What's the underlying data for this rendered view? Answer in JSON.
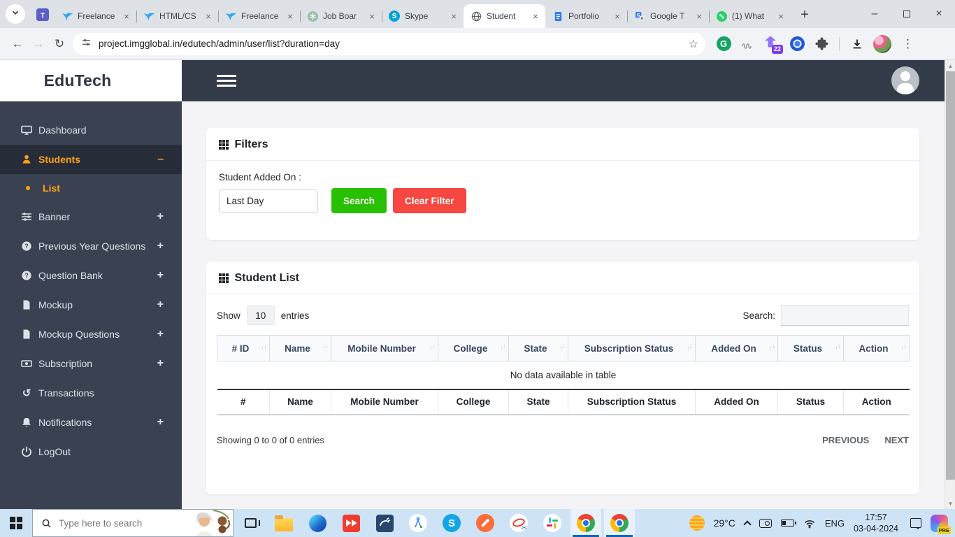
{
  "glyphs": {
    "close": "×",
    "plus": "+",
    "minus": "–",
    "back": "←",
    "forward": "→",
    "reload": "↻",
    "star": "☆",
    "menu_dots": "⋮",
    "scroll_up": "▲",
    "scroll_down": "▼",
    "sort_up": "↑",
    "sort_down": "↓",
    "window_min": "–",
    "window_close": "×",
    "new_tab": "+",
    "scissors": "✂",
    "history": "↺"
  },
  "browser": {
    "tabs": [
      {
        "label": "Freelance"
      },
      {
        "label": "HTML/CS"
      },
      {
        "label": "Freelance"
      },
      {
        "label": "Job Boar"
      },
      {
        "label": "Skype"
      },
      {
        "label": "Student"
      },
      {
        "label": "Portfolio"
      },
      {
        "label": "Google T"
      },
      {
        "label": "(1) What"
      }
    ],
    "url": "project.imgglobal.in/edutech/admin/user/list?duration=day",
    "extension_badge": "22"
  },
  "admin": {
    "brand": "EduTech",
    "menu": [
      {
        "label": "Dashboard"
      },
      {
        "label": "Students",
        "toggle": "–"
      },
      {
        "label": "List"
      },
      {
        "label": "Banner",
        "toggle": "+"
      },
      {
        "label": "Previous Year Questions",
        "toggle": "+"
      },
      {
        "label": "Question Bank",
        "toggle": "+"
      },
      {
        "label": "Mockup",
        "toggle": "+"
      },
      {
        "label": "Mockup Questions",
        "toggle": "+"
      },
      {
        "label": "Subscription",
        "toggle": "+"
      },
      {
        "label": "Transactions"
      },
      {
        "label": "Notifications",
        "toggle": "+"
      },
      {
        "label": "LogOut"
      }
    ]
  },
  "filters": {
    "title": "Filters",
    "field_label": "Student Added On :",
    "field_value": "Last Day",
    "search_button": "Search",
    "clear_button": "Clear Filter"
  },
  "student_list": {
    "title": "Student List",
    "show_label": "Show",
    "page_size": "10",
    "entries_label": "entries",
    "search_label": "Search:",
    "search_value": "",
    "columns": [
      "# ID",
      "Name",
      "Mobile Number",
      "College",
      "State",
      "Subscription Status",
      "Added On",
      "Status",
      "Action"
    ],
    "empty_message": "No data available in table",
    "footer_columns": [
      "#",
      "Name",
      "Mobile Number",
      "College",
      "State",
      "Subscription Status",
      "Added On",
      "Status",
      "Action"
    ],
    "info": "Showing 0 to 0 of 0 entries",
    "previous_label": "PREVIOUS",
    "next_label": "NEXT"
  },
  "taskbar": {
    "search_placeholder": "Type here to search",
    "temperature": "29°C",
    "language": "ENG",
    "time": "17:57",
    "date": "03-04-2024",
    "copilot_badge": "PRE"
  },
  "colors": {
    "accent_orange": "#ffa117",
    "button_green": "#28c101",
    "button_red": "#f64740",
    "sidebar_bg": "#3a4252",
    "topbar_bg": "#343b48",
    "taskbar_bg": "#cfe3f6"
  }
}
